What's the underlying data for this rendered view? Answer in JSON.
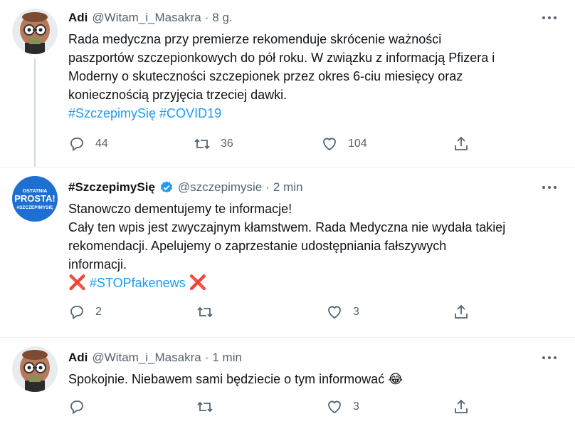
{
  "tweets": [
    {
      "name": "Adi",
      "handle": "@Witam_i_Masakra",
      "time": "8 g.",
      "text_lines": [
        "Rada medyczna przy premierze rekomenduje skrócenie ważności",
        "paszportów szczepionkowych do pół roku. W związku z informacją Pfizera i",
        "Moderny o skuteczności szczepionek przez okres 6-ciu miesięcy oraz",
        "koniecznością przyjęcia trzeciej dawki."
      ],
      "hashtags": "#SzczepimySię #COVID19",
      "replies": "44",
      "retweets": "36",
      "likes": "104"
    },
    {
      "name": "#SzczepimySię",
      "handle": "@szczepimysie",
      "time": "2 min",
      "text_lines": [
        "Stanowczo dementujemy te informacje!",
        "Cały ten wpis jest zwyczajnym kłamstwem. Rada Medyczna nie wydała takiej",
        "rekomendacji. Apelujemy o zaprzestanie udostępniania fałszywych",
        "informacji."
      ],
      "cross_left": "❌",
      "hashtag": "#STOPfakenews",
      "cross_right": "❌",
      "avatar_text_top": "OSTATNIA",
      "avatar_text_mid": "PROSTA!",
      "avatar_text_bottom": "#SZCZEPIMYSIĘ",
      "replies": "2",
      "retweets": "",
      "likes": "3"
    },
    {
      "name": "Adi",
      "handle": "@Witam_i_Masakra",
      "time": "1 min",
      "text": "Spokojnie. Niebawem sami będziecie o tym informować",
      "emoji": "😂",
      "replies": "",
      "retweets": "",
      "likes": "3"
    }
  ],
  "colors": {
    "accent": "#1d9bf0",
    "muted": "#536471",
    "avatar_blue": "#1d6fd1"
  }
}
